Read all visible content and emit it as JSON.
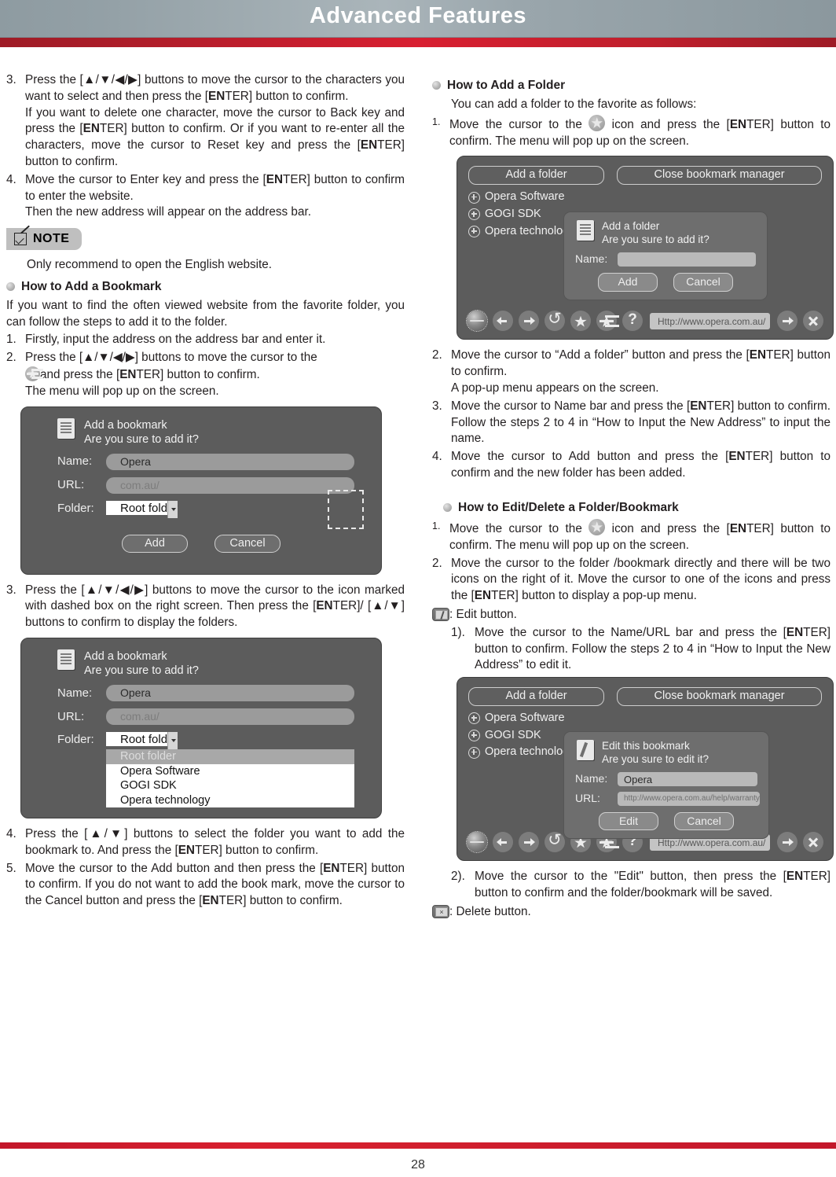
{
  "header": {
    "title": "Advanced Features"
  },
  "footer": {
    "page_number": "28"
  },
  "left": {
    "step3": {
      "num": "3.",
      "p1_a": "Press the [",
      "p1_keys": "▲/▼/◀/▶",
      "p1_b": "] buttons to move the cursor to the characters you want to select and then press the [",
      "p1_en": "EN",
      "p1_c": "TER] button to confirm.",
      "p2_a": "If you want to delete one character, move the cursor to Back key and press the [",
      "p2_en": "EN",
      "p2_b": "TER] button to confirm. Or if you want to re-enter all the characters, move the cursor to Reset key and press the [",
      "p2_en2": "EN",
      "p2_c": "TER] button to confirm."
    },
    "step4": {
      "num": "4.",
      "p1_a": "Move the cursor to Enter key and press the [",
      "p1_en": "EN",
      "p1_b": "TER] button to confirm to enter the website.",
      "p2": "Then the new address will appear on the address bar."
    },
    "note": {
      "label": "NOTE",
      "body": "Only recommend to open the English website."
    },
    "bookmark_section": {
      "heading": "How to Add a Bookmark",
      "intro": "If you want to find the often viewed website from the favorite folder, you can follow the steps to add it to the folder.",
      "s1_num": "1.",
      "s1_text": "Firstly, input the address on the address bar and enter it.",
      "s2_num": "2.",
      "s2_a": "Press the [",
      "s2_keys": "▲/▼/◀/▶",
      "s2_b": "] buttons to move the cursor to the",
      "s2_c": "and press the [",
      "s2_en": "EN",
      "s2_d": "TER] button to confirm.",
      "s2_e": "The menu will pop up on the screen.",
      "s3_num": "3.",
      "s3_a": "Press the [",
      "s3_keys": "▲/▼/◀/▶",
      "s3_b": "] buttons to move the cursor to the icon marked with dashed box on the right screen. Then press the [",
      "s3_en": "EN",
      "s3_c": "TER]/ [",
      "s3_keys2": "▲/▼",
      "s3_d": "] buttons to confirm to display the folders.",
      "s4_num": "4.",
      "s4_a": "Press the [",
      "s4_keys": "▲/▼",
      "s4_b": "] buttons to select the folder you want to add the bookmark to. And press the [",
      "s4_en": "EN",
      "s4_c": "TER] button to confirm.",
      "s5_num": "5.",
      "s5_a": "Move the cursor to the Add button and then press the [",
      "s5_en": "EN",
      "s5_b": "TER] button to confirm. If you do not want to add the book mark, move the cursor to the Cancel button and press the [",
      "s5_en2": "EN",
      "s5_c": "TER] button to confirm."
    },
    "dialog1": {
      "title": "Add a bookmark",
      "subtitle": "Are you sure to add it?",
      "name_label": "Name:",
      "name_value": "Opera",
      "url_label": "URL:",
      "url_value": "com.au/",
      "folder_label": "Folder:",
      "folder_value": "Root folder",
      "add_button": "Add",
      "cancel_button": "Cancel"
    },
    "dialog2": {
      "title": "Add a bookmark",
      "subtitle": "Are you sure to add it?",
      "name_label": "Name:",
      "name_value": "Opera",
      "url_label": "URL:",
      "url_value": "com.au/",
      "folder_label": "Folder:",
      "folder_value": "Root folder",
      "options": [
        "Root folder",
        "Opera Software",
        "GOGI SDK",
        "Opera technology"
      ]
    }
  },
  "right": {
    "folder_section": {
      "heading": "How to Add a Folder",
      "intro": "You can add a folder to the favorite as follows:",
      "s1_num": "1.",
      "s1_a": "Move the cursor to the",
      "s1_b": "icon and press the [",
      "s1_en": "EN",
      "s1_c": "TER] button to confirm. The menu will pop up on the screen.",
      "s2_num": "2.",
      "s2_a": "Move the cursor to “Add a folder” button and press the [",
      "s2_en": "EN",
      "s2_b": "TER] button to confirm.",
      "s2_c": "A pop-up menu appears on the screen.",
      "s3_num": "3.",
      "s3_a": "Move the cursor to Name bar and press the [",
      "s3_en": "EN",
      "s3_b": "TER] button to confirm. Follow the steps 2 to 4 in “How to Input the New Address” to input the name.",
      "s4_num": "4.",
      "s4_a": "Move the cursor to Add button and press the [",
      "s4_en": "EN",
      "s4_b": "TER] button to confirm and the new folder has been added."
    },
    "edit_section": {
      "heading": "How to Edit/Delete a Folder/Bookmark",
      "s1_num": "1.",
      "s1_a": "Move the cursor to the",
      "s1_b": "icon and press the [",
      "s1_en": "EN",
      "s1_c": "TER] button to confirm. The menu will pop up on the screen.",
      "s2_num": "2.",
      "s2_a": "Move the cursor to the folder /bookmark directly and there will be two icons on the right of it. Move the cursor to one of the icons and press the [",
      "s2_en": "EN",
      "s2_b": "TER] button to display a pop-up menu.",
      "edit_caption": ": Edit button.",
      "sub1_num": "1).",
      "sub1_a": "Move the cursor to the Name/URL bar and press the [",
      "sub1_en": "EN",
      "sub1_b": "TER] button to confirm. Follow the steps 2 to 4 in “How to Input the New Address” to edit it.",
      "sub2_num": "2).",
      "sub2_a": "Move the cursor to the \"Edit\" button, then press the [",
      "sub2_en": "EN",
      "sub2_b": "TER] button to confirm and the folder/bookmark will be saved.",
      "delete_caption": ": Delete button."
    },
    "browser1": {
      "add_folder_tab": "Add a folder",
      "close_manager_tab": "Close bookmark manager",
      "tree": [
        "Opera Software",
        "GOGI SDK",
        "Opera technology"
      ],
      "popup": {
        "title": "Add a folder",
        "subtitle": "Are you sure to add it?",
        "name_label": "Name:",
        "name_value": "",
        "add_button": "Add",
        "cancel_button": "Cancel"
      },
      "url": "Http://www.opera.com.au/"
    },
    "browser2": {
      "add_folder_tab": "Add a folder",
      "close_manager_tab": "Close bookmark manager",
      "tree": [
        "Opera Software",
        "GOGI SDK",
        "Opera technology"
      ],
      "popup": {
        "title": "Edit this bookmark",
        "subtitle": "Are you sure to edit it?",
        "name_label": "Name:",
        "name_value": "Opera",
        "url_label": "URL:",
        "url_value": "http://www.opera.com.au/help/warranty",
        "edit_button": "Edit",
        "cancel_button": "Cancel"
      },
      "url": "Http://www.opera.com.au/"
    }
  }
}
